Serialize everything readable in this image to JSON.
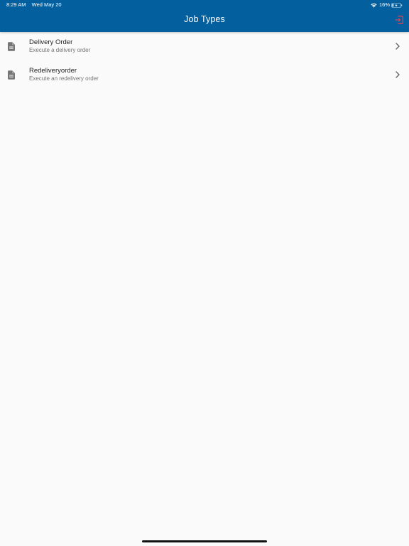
{
  "status_bar": {
    "time": "8:29 AM",
    "date": "Wed May 20",
    "battery_percent": "16%",
    "battery_level": 0.16,
    "icons": [
      "wifi-icon",
      "battery-charging-icon"
    ]
  },
  "header": {
    "title": "Job Types",
    "logout_icon": "logout-icon"
  },
  "colors": {
    "header_bg": "#045f9f",
    "logout_icon": "#e8434b",
    "background": "#fafafa"
  },
  "job_types": [
    {
      "title": "Delivery Order",
      "subtitle": "Execute a delivery order",
      "icon": "document-icon"
    },
    {
      "title": "Redeliveryorder",
      "subtitle": "Execute an redelivery order",
      "icon": "document-icon"
    }
  ]
}
